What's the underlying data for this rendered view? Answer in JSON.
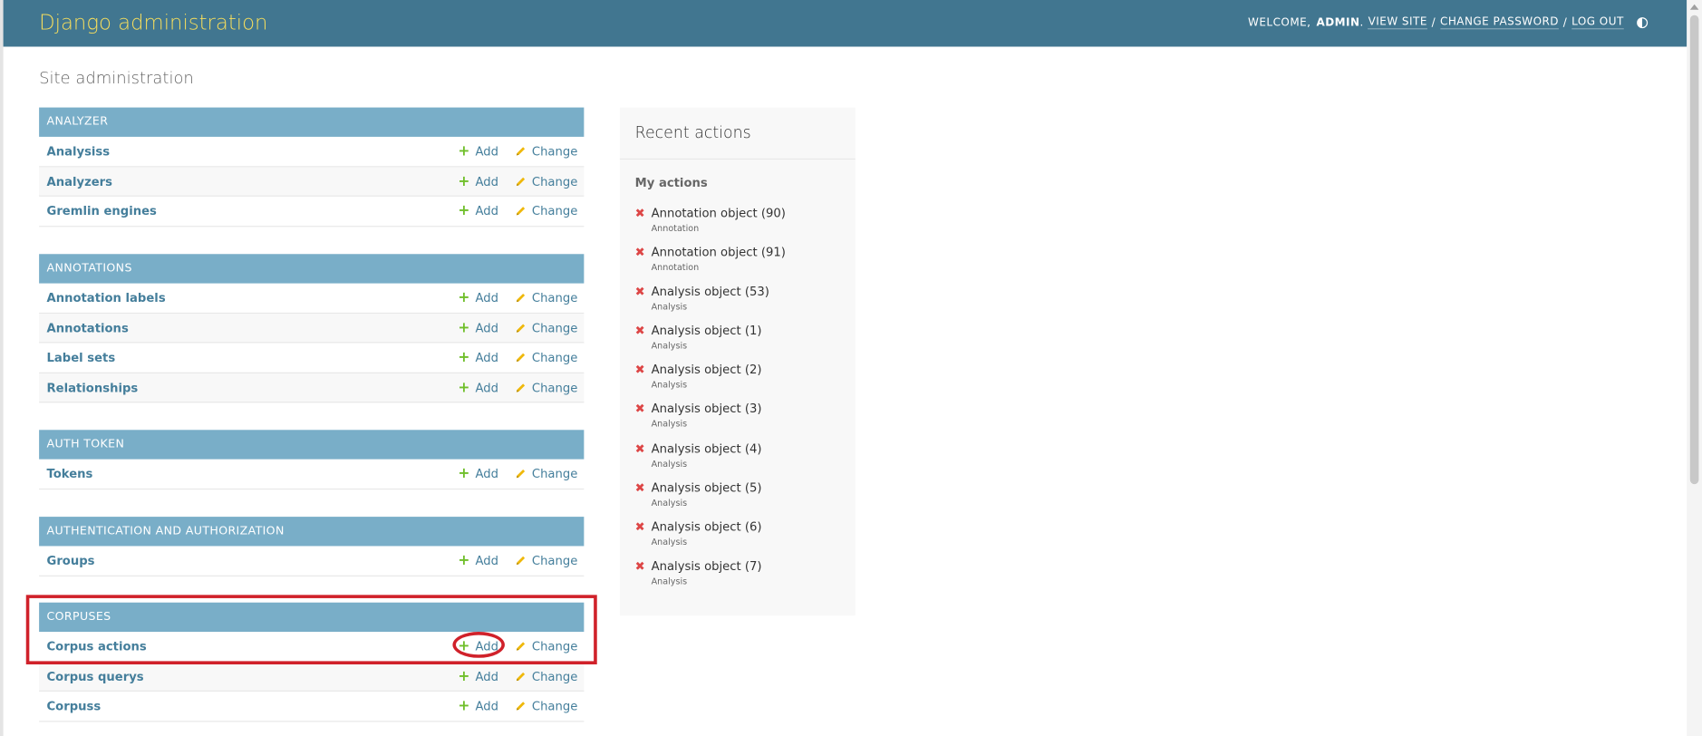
{
  "header": {
    "brand": "Django administration",
    "welcome_text": "WELCOME,",
    "username": "ADMIN",
    "period": ".",
    "view_site": "VIEW SITE",
    "sep1": "/",
    "change_password": "CHANGE PASSWORD",
    "sep2": "/",
    "log_out": "LOG OUT"
  },
  "page": {
    "title": "Site administration"
  },
  "common": {
    "add_label": "Add",
    "change_label": "Change"
  },
  "modules": [
    {
      "caption": "ANALYZER",
      "models": [
        "Analysiss",
        "Analyzers",
        "Gremlin engines"
      ]
    },
    {
      "caption": "ANNOTATIONS",
      "models": [
        "Annotation labels",
        "Annotations",
        "Label sets",
        "Relationships"
      ]
    },
    {
      "caption": "AUTH TOKEN",
      "models": [
        "Tokens"
      ]
    },
    {
      "caption": "AUTHENTICATION AND AUTHORIZATION",
      "models": [
        "Groups"
      ]
    },
    {
      "caption": "CORPUSES",
      "models": [
        "Corpus actions",
        "Corpus querys",
        "Corpuss"
      ]
    }
  ],
  "recent_actions": {
    "title": "Recent actions",
    "my_actions": "My actions",
    "items": [
      {
        "object": "Annotation object (90)",
        "type": "Annotation"
      },
      {
        "object": "Annotation object (91)",
        "type": "Annotation"
      },
      {
        "object": "Analysis object (53)",
        "type": "Analysis"
      },
      {
        "object": "Analysis object (1)",
        "type": "Analysis"
      },
      {
        "object": "Analysis object (2)",
        "type": "Analysis"
      },
      {
        "object": "Analysis object (3)",
        "type": "Analysis"
      },
      {
        "object": "Analysis object (4)",
        "type": "Analysis"
      },
      {
        "object": "Analysis object (5)",
        "type": "Analysis"
      },
      {
        "object": "Analysis object (6)",
        "type": "Analysis"
      },
      {
        "object": "Analysis object (7)",
        "type": "Analysis"
      }
    ]
  },
  "colors": {
    "header_bg": "#417690",
    "brand": "#f5dd5d",
    "caption_bg": "#79aec8",
    "link": "#447e9b",
    "add_icon": "#70bf2b",
    "change_icon": "#efb80b",
    "delete_icon": "#dd4646",
    "annotation_red": "#d0212a"
  },
  "icons": {
    "add": "plus-icon",
    "change": "pencil-icon",
    "delete": "x-icon",
    "theme": "theme-toggle-icon"
  }
}
